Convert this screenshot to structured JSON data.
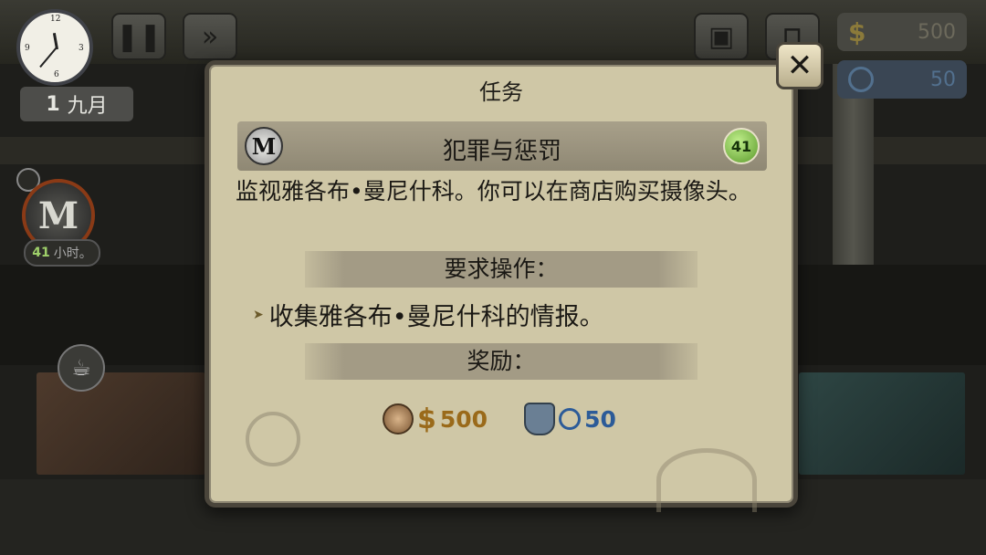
{
  "hud": {
    "date_day": "1",
    "date_month": "九月",
    "money": "500",
    "reputation": "50",
    "pause_icon": "pause-icon",
    "fast_forward_icon": "fast-forward-icon",
    "side_timer_value": "41",
    "side_timer_unit": "小时。"
  },
  "dialog": {
    "title": "任务",
    "quest_name": "犯罪与惩罚",
    "quest_level": "41",
    "quest_icon_letter": "M",
    "description": "监视雅各布•曼尼什科。你可以在商店购买摄像头。",
    "requirements_heading": "要求操作：",
    "tasks": [
      "收集雅各布•曼尼什科的情报。"
    ],
    "rewards_heading": "奖励：",
    "reward_money_symbol": "$",
    "reward_money": "500",
    "reward_reputation": "50",
    "close_symbol": "✕"
  },
  "colors": {
    "dialog_bg": "#cfc7a6",
    "money_reward": "#9a6a1a",
    "reputation_reward": "#2c5b98",
    "level_badge": "#5b9a2c"
  }
}
